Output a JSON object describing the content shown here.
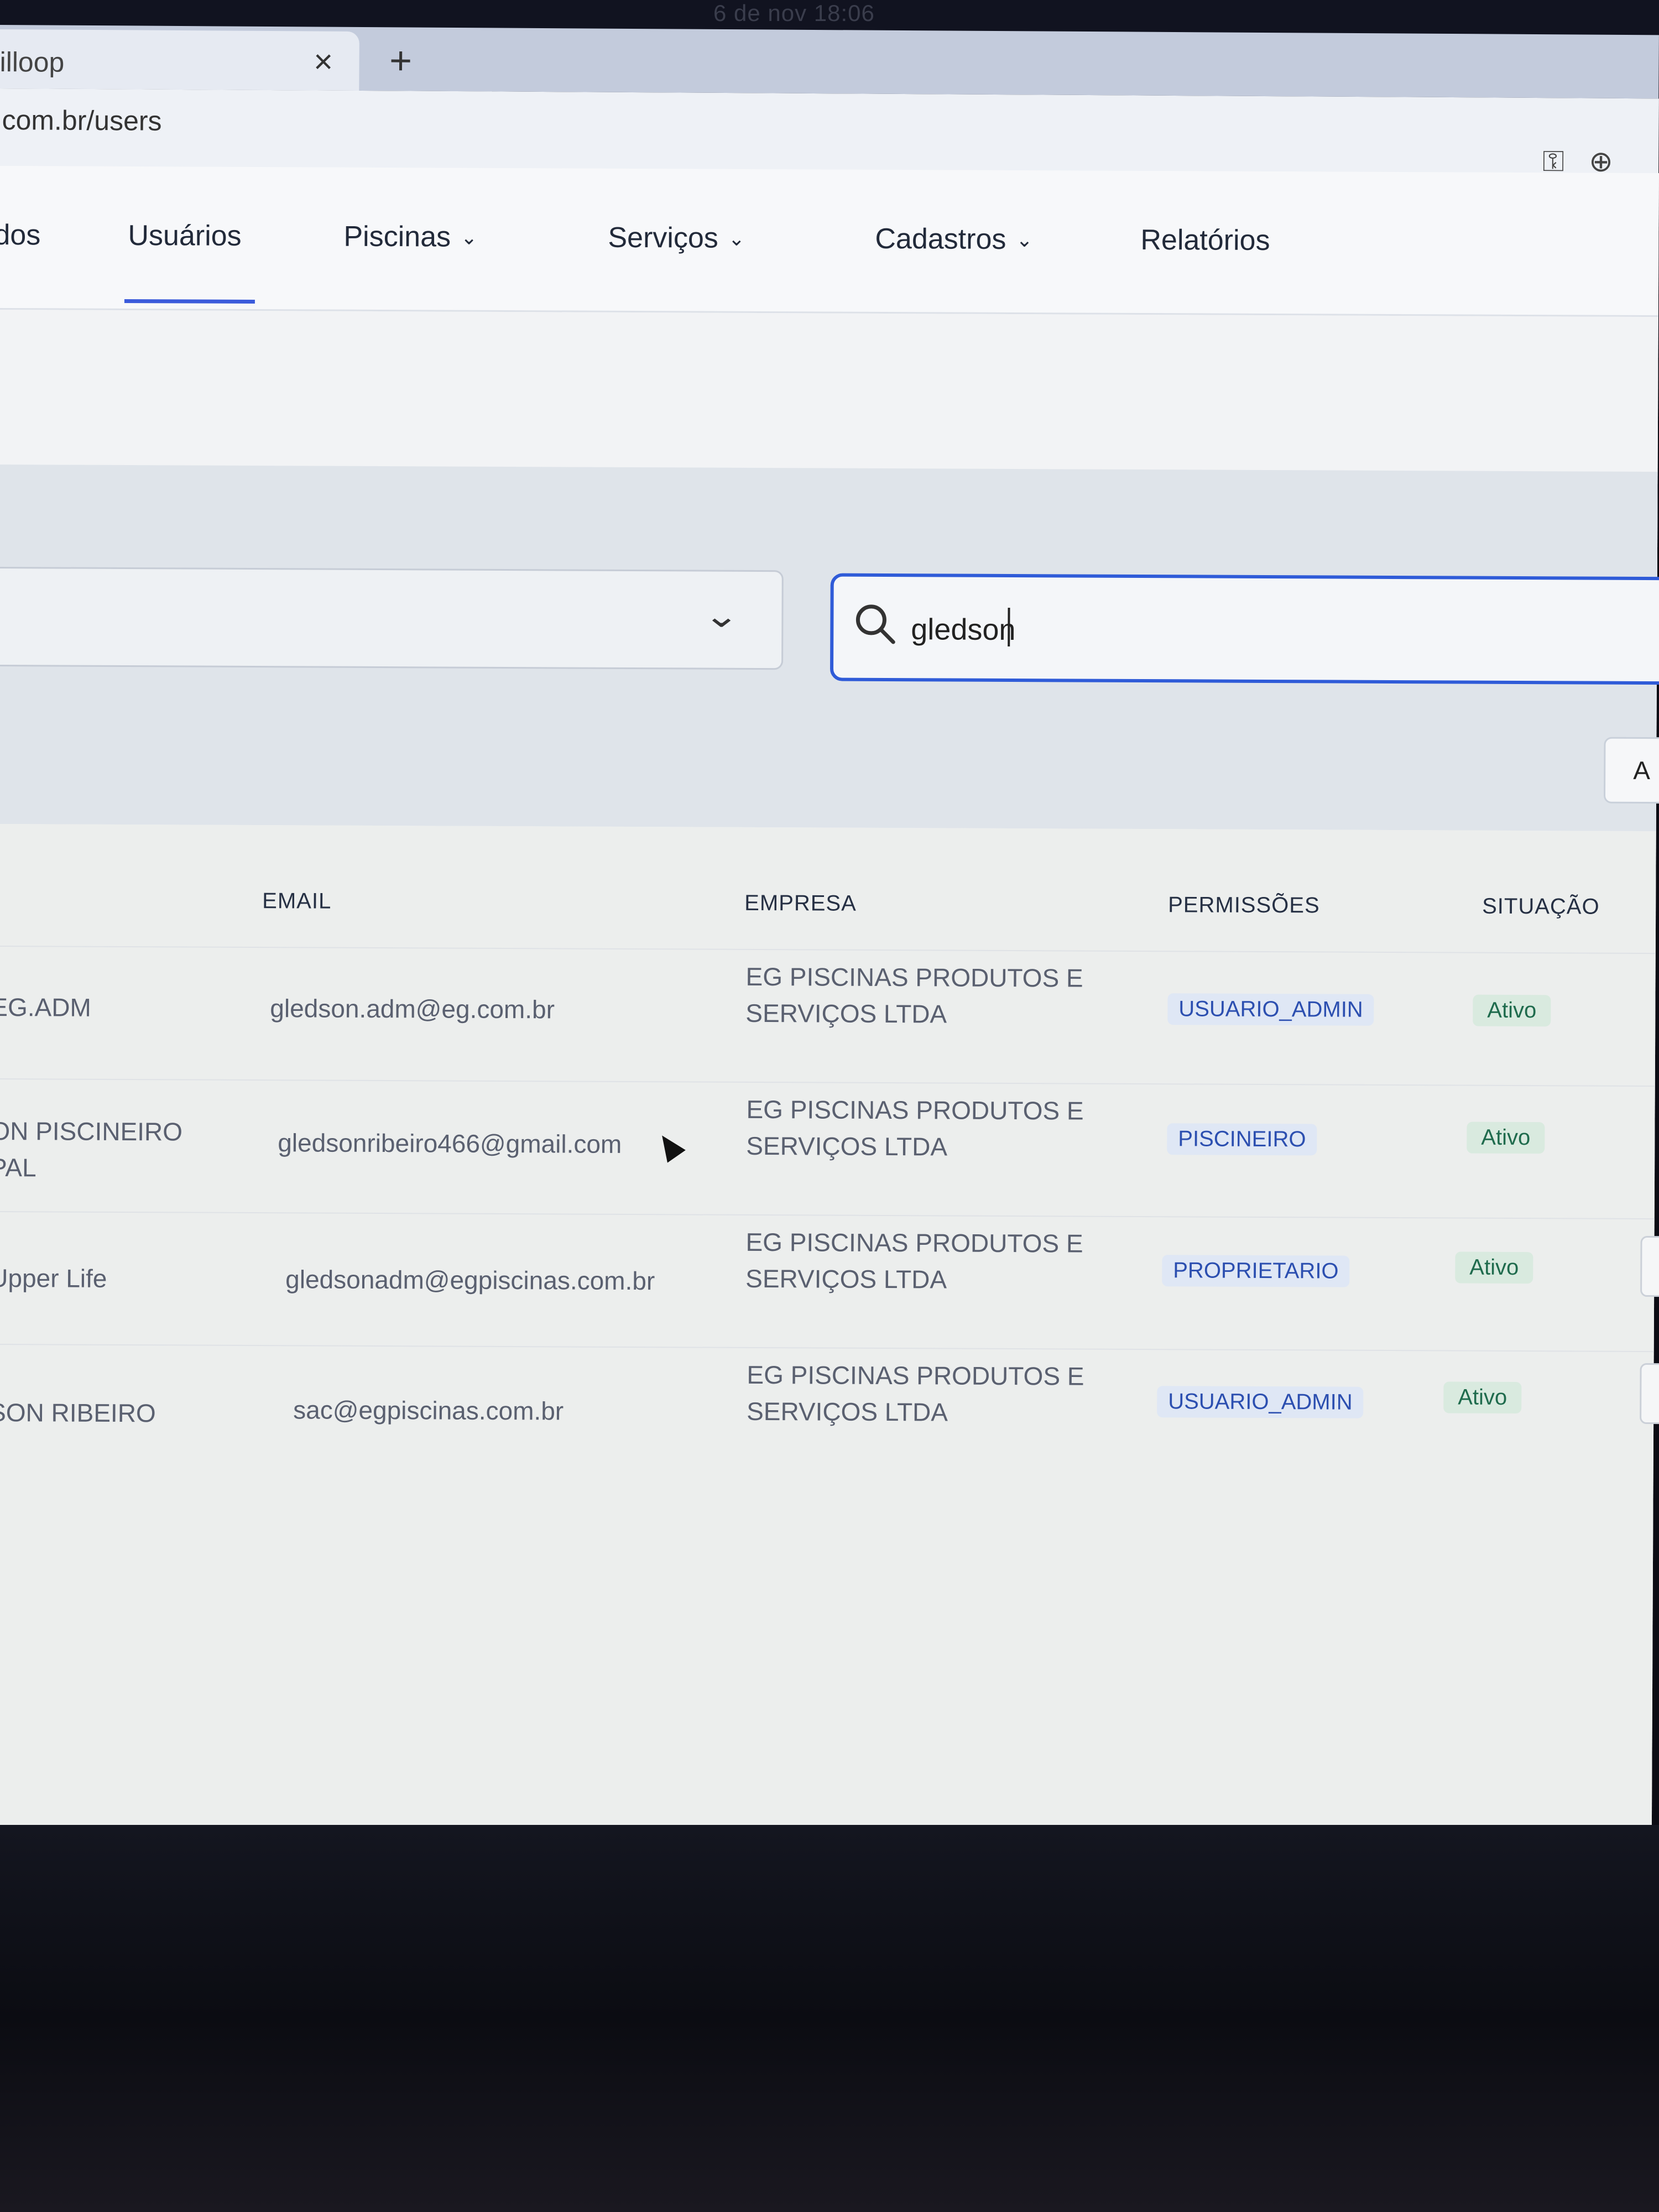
{
  "os": {
    "clock": "6 de nov  18:06"
  },
  "browser": {
    "tab_title": "illoop",
    "tab_close": "×",
    "new_tab": "+",
    "url": ".com.br/users"
  },
  "nav": {
    "items": [
      {
        "label": "dos",
        "has_chevron": false
      },
      {
        "label": "Usuários",
        "has_chevron": false,
        "active": true
      },
      {
        "label": "Piscinas",
        "has_chevron": true
      },
      {
        "label": "Serviços",
        "has_chevron": true
      },
      {
        "label": "Cadastros",
        "has_chevron": true
      },
      {
        "label": "Relatórios",
        "has_chevron": false
      }
    ]
  },
  "filters": {
    "select_value": "",
    "search_value": "gledson",
    "side_button_label": "A"
  },
  "table": {
    "headers": [
      "EMAIL",
      "EMPRESA",
      "PERMISSÕES",
      "SITUAÇÃO"
    ],
    "rows": [
      {
        "name_lines": [
          "EG.ADM"
        ],
        "email": "gledson.adm@eg.com.br",
        "company_lines": [
          "EG PISCINAS PRODUTOS E",
          "SERVIÇOS LTDA"
        ],
        "permission": "USUARIO_ADMIN",
        "status": "Ativo"
      },
      {
        "name_lines": [
          "ON PISCINEIRO",
          "PAL"
        ],
        "email": "gledsonribeiro466@gmail.com",
        "company_lines": [
          "EG PISCINAS PRODUTOS E",
          "SERVIÇOS LTDA"
        ],
        "permission": "PISCINEIRO",
        "status": "Ativo"
      },
      {
        "name_lines": [
          "Upper Life"
        ],
        "email": "gledsonadm@egpiscinas.com.br",
        "company_lines": [
          "EG PISCINAS PRODUTOS E",
          "SERVIÇOS LTDA"
        ],
        "permission": "PROPRIETARIO",
        "status": "Ativo"
      },
      {
        "name_lines": [
          "SON RIBEIRO"
        ],
        "email": "sac@egpiscinas.com.br",
        "company_lines": [
          "EG PISCINAS PRODUTOS E",
          "SERVIÇOS LTDA"
        ],
        "permission": "USUARIO_ADMIN",
        "status": "Ativo"
      }
    ]
  }
}
